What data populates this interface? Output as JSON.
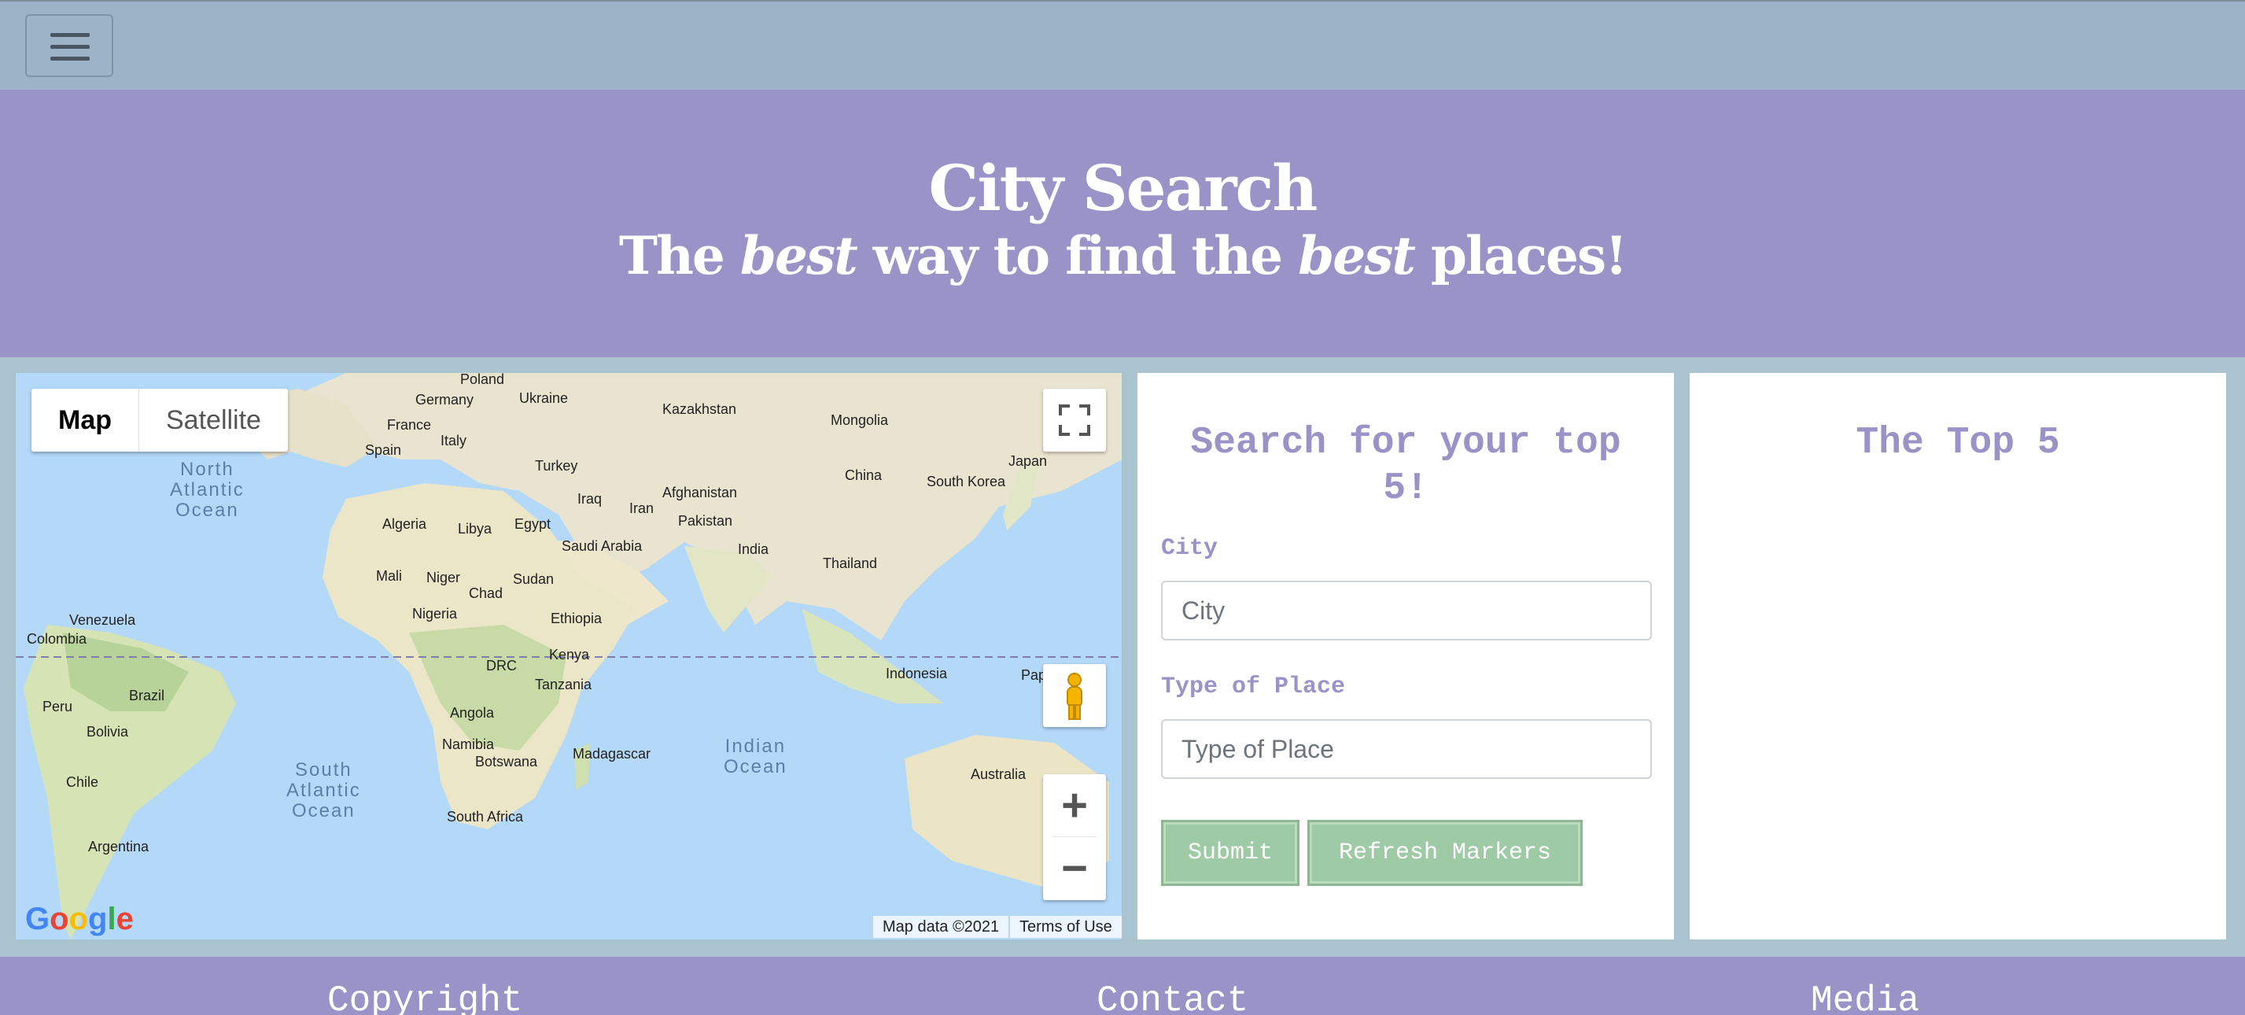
{
  "navbar": {
    "menu_icon": "hamburger-menu-icon"
  },
  "hero": {
    "title": "City Search",
    "subtitle_parts": [
      "The ",
      "best",
      " way to find the ",
      "best",
      " places!"
    ]
  },
  "map": {
    "maptype_map": "Map",
    "maptype_satellite": "Satellite",
    "logo": "Google",
    "attribution": "Map data ©2021",
    "terms": "Terms of Use",
    "labels": [
      "Poland",
      "Germany",
      "Ukraine",
      "Kazakhstan",
      "Mongolia",
      "France",
      "Italy",
      "Spain",
      "Turkey",
      "Japan",
      "China",
      "South Korea",
      "Iraq",
      "Afghanistan",
      "Iran",
      "Algeria",
      "Libya",
      "Egypt",
      "Pakistan",
      "Saudi Arabia",
      "India",
      "Thailand",
      "Mali",
      "Niger",
      "Chad",
      "Sudan",
      "Nigeria",
      "Ethiopia",
      "Venezuela",
      "Colombia",
      "DRC",
      "Kenya",
      "Indonesia",
      "Pap",
      "Brazil",
      "Tanzania",
      "Peru",
      "Angola",
      "Bolivia",
      "Namibia",
      "Madagascar",
      "Botswana",
      "Australia",
      "Chile",
      "South Africa",
      "Argentina"
    ],
    "oceans": {
      "north_atlantic": [
        "North",
        "Atlantic",
        "Ocean"
      ],
      "south_atlantic": [
        "South",
        "Atlantic",
        "Ocean"
      ],
      "indian": [
        "Indian",
        "Ocean"
      ]
    }
  },
  "search": {
    "title": "Search for your top 5!",
    "city_label": "City",
    "city_placeholder": "City",
    "type_label": "Type of Place",
    "type_placeholder": "Type of Place",
    "submit": "Submit",
    "refresh": "Refresh Markers"
  },
  "top5": {
    "title": "The Top 5"
  },
  "footer": {
    "copyright": "Copyright",
    "contact": "Contact",
    "media": "Media"
  },
  "colors": {
    "navbar": "#9db3c8",
    "hero": "#9a93c7",
    "main_bg": "#a9c3cf",
    "button": "#9fcaa6",
    "heading": "#9a93c7"
  }
}
